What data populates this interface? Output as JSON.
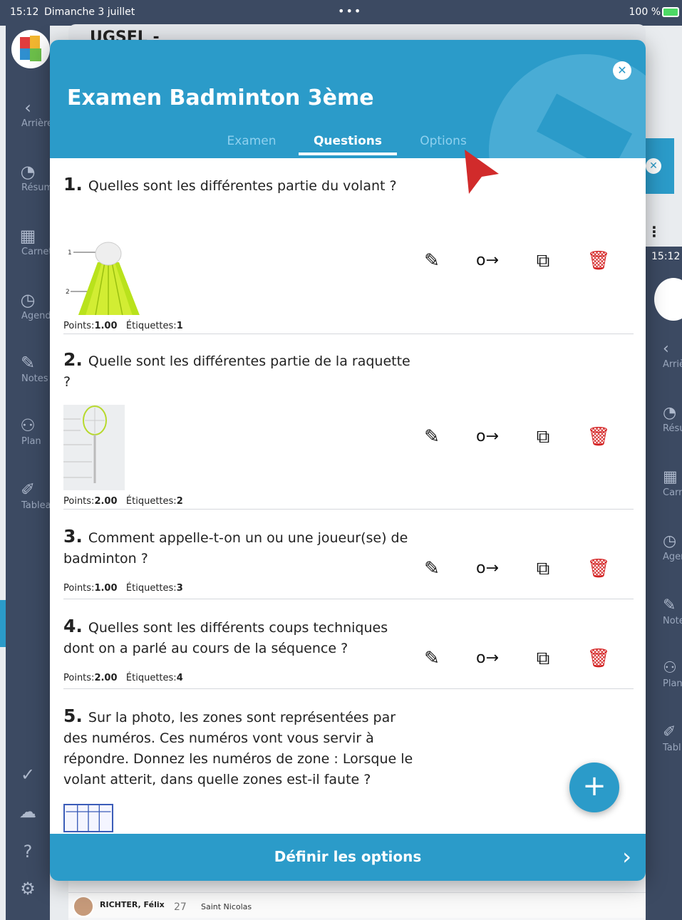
{
  "status_bar": {
    "time": "15:12",
    "date": "Dimanche 3 juillet",
    "dots": "•••",
    "battery": "100 %"
  },
  "sidebar": {
    "items": [
      {
        "label": "Arrière",
        "icon": "back-chevron-icon"
      },
      {
        "label": "Résumé",
        "icon": "pie-chart-icon"
      },
      {
        "label": "Carnet",
        "icon": "grid-icon"
      },
      {
        "label": "Agenda",
        "icon": "clock-icon"
      },
      {
        "label": "Notes",
        "icon": "pencil-icon"
      },
      {
        "label": "Plan",
        "icon": "people-icon"
      },
      {
        "label": "Tableau",
        "icon": "pin-icon"
      }
    ],
    "bottom_icons": [
      "check-circle-icon",
      "cloud-upload-icon",
      "help-icon",
      "settings-icon"
    ]
  },
  "right_panel": {
    "time": "15:12",
    "items": [
      {
        "label": "Arriè"
      },
      {
        "label": "Résu"
      },
      {
        "label": "Carn"
      },
      {
        "label": "Agen"
      },
      {
        "label": "Note"
      },
      {
        "label": "Plan"
      },
      {
        "label": "Tabl"
      }
    ]
  },
  "background": {
    "header_title": "UGSEL -",
    "student": {
      "name": "RICHTER, Félix",
      "number": "27",
      "class": "Saint Nicolas"
    }
  },
  "modal": {
    "title": "Examen Badminton 3ème",
    "close_icon": "close-icon",
    "tabs": [
      {
        "label": "Examen",
        "active": false
      },
      {
        "label": "Questions",
        "active": true
      },
      {
        "label": "Options",
        "active": false
      }
    ],
    "questions": [
      {
        "num": "1.",
        "text": "Quelles sont les différentes partie du volant ?",
        "points_label": "Points:",
        "points": "1.00",
        "tags_label": "Étiquettes:",
        "tags": "1",
        "image": "shuttlecock-diagram"
      },
      {
        "num": "2.",
        "text": "Quelle sont les différentes partie de la raquette ?",
        "points_label": "Points:",
        "points": "2.00",
        "tags_label": "Étiquettes:",
        "tags": "2",
        "image": "racket-diagram"
      },
      {
        "num": "3.",
        "text": "Comment appelle-t-on un ou une joueur(se) de badminton ?",
        "points_label": "Points:",
        "points": "1.00",
        "tags_label": "Étiquettes:",
        "tags": "3"
      },
      {
        "num": "4.",
        "text": "Quelles sont les différents coups techniques dont on a parlé au cours de la séquence ?",
        "points_label": "Points:",
        "points": "2.00",
        "tags_label": "Étiquettes:",
        "tags": "4"
      },
      {
        "num": "5.",
        "text": "Sur la photo, les zones sont représentées par des numéros. Ces numéros vont vous servir à répondre. Donnez les numéros de zone : Lorsque le volant atterit, dans quelle zones est-il faute ?",
        "image": "court-diagram"
      }
    ],
    "action_icons": [
      "edit-pencil-icon",
      "move-arrow-icon",
      "duplicate-icon",
      "delete-trash-icon"
    ],
    "action_glyphs": {
      "edit": "✎",
      "move": "o→",
      "copy": "⧉",
      "delete": "🗑"
    },
    "fab_label": "+",
    "footer_label": "Définir les options",
    "footer_chevron": "›"
  },
  "colors": {
    "accent": "#2b9bc9",
    "sidebar": "#3c4a62",
    "delete": "#d32020",
    "cursor": "#d12b2b"
  }
}
